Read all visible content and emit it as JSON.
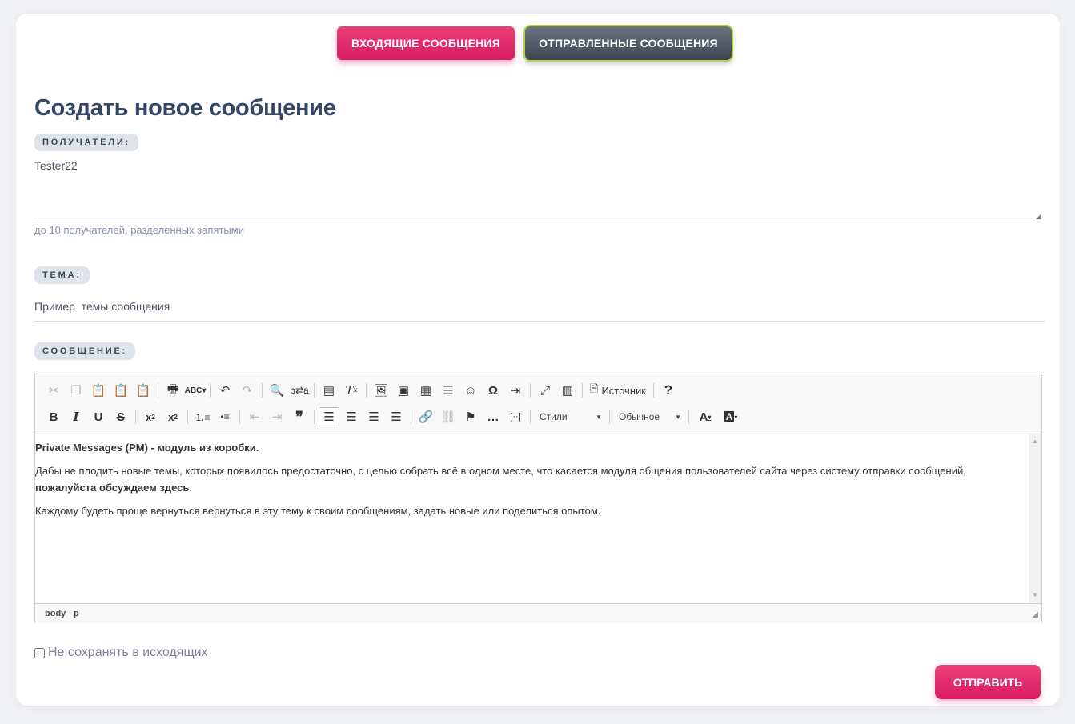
{
  "tabs": {
    "inbox_label": "ВХОДЯЩИЕ СООБЩЕНИЯ",
    "sent_label": "ОТПРАВЛЕННЫЕ СООБЩЕНИЯ"
  },
  "page": {
    "title": "Создать новое сообщение"
  },
  "recipients": {
    "label": "ПОЛУЧАТЕЛИ:",
    "value": "Tester22",
    "hint": "до 10 получателей, разделенных запятыми"
  },
  "subject": {
    "label": "ТЕМА:",
    "value": "Пример  темы сообщения"
  },
  "message": {
    "label": "СООБЩЕНИЕ:",
    "toolbar": {
      "source_label": "Источник",
      "styles_label": "Стили",
      "format_label": "Обычное"
    },
    "content": {
      "p1_bold": "Private Messages (PM) - модуль из коробки.",
      "p2_text": "Дабы не плодить новые темы, которых появилось предостаточно, с целью собрать всё в одном месте, что касается модуля общения пользователей сайта через систему отправки сообщений, ",
      "p2_bold": "пожалуйста обсуждаем здесь",
      "p2_end": ".",
      "p3_text": "Каждому будеть проще вернуться вернуться в эту тему к своим сообщениям, задать новые или поделиться опытом."
    },
    "path": [
      "body",
      "p"
    ]
  },
  "options": {
    "no_save_label": "Не сохранять в исходящих"
  },
  "actions": {
    "send_label": "ОТПРАВИТЬ"
  },
  "colors": {
    "accent": "#e91e63",
    "title": "#344767",
    "dark_button": "#4b5260"
  }
}
